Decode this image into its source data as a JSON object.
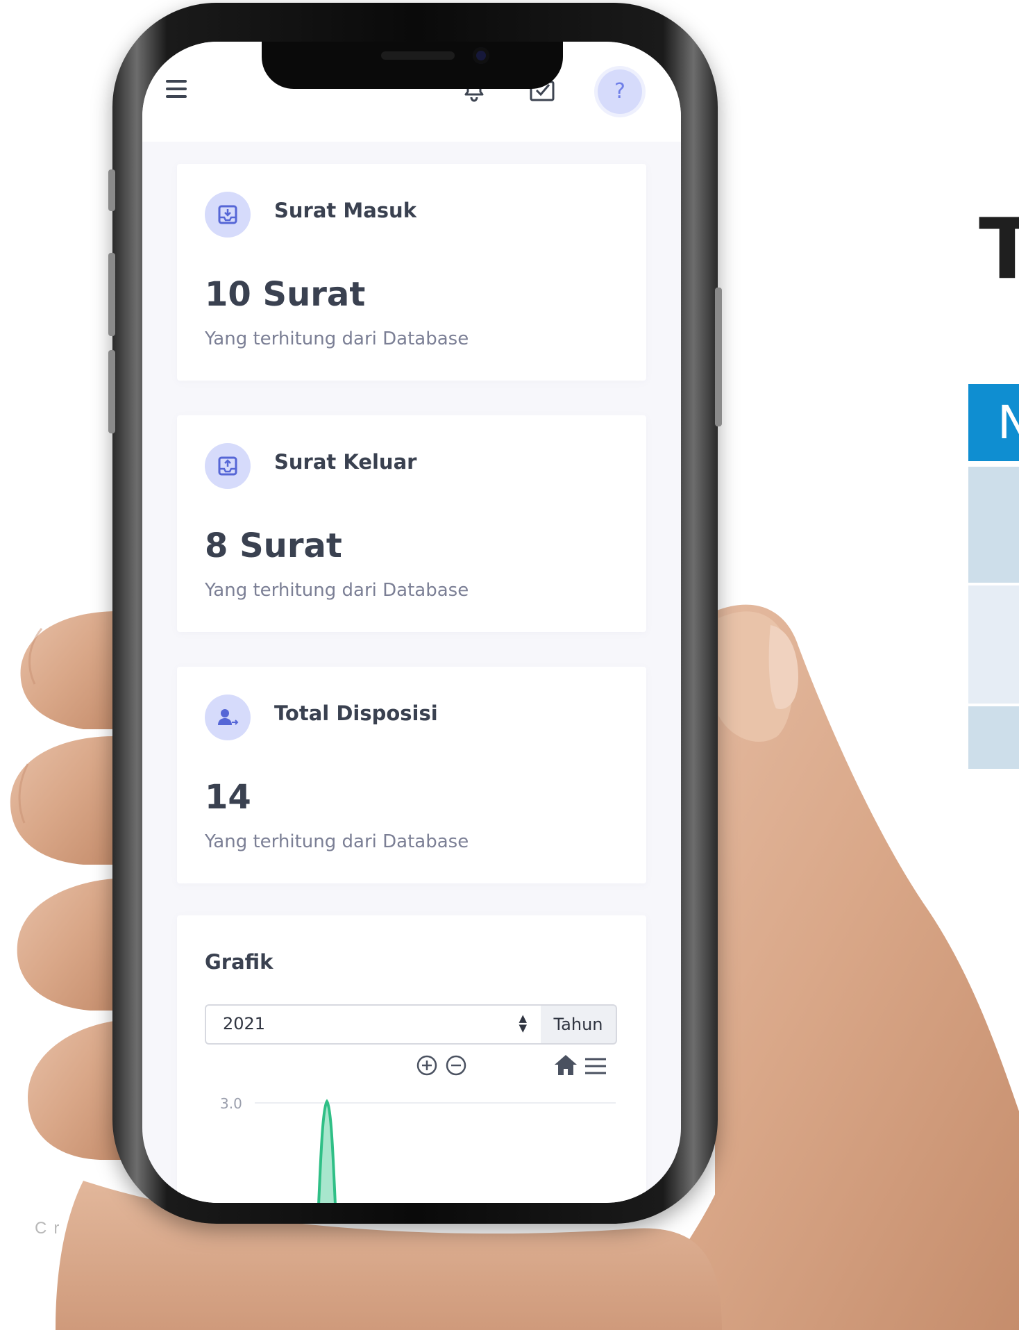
{
  "background": {
    "heading_letter": "T",
    "table_header_letter": "N",
    "caption_fragment": "Cr"
  },
  "topbar": {
    "menu_icon": "hamburger-icon",
    "bell_icon": "bell-icon",
    "inbox_icon": "inbox-check-icon",
    "help_label": "?"
  },
  "cards": [
    {
      "title": "Surat Masuk",
      "value": "10 Surat",
      "subtitle": "Yang terhitung dari Database",
      "icon": "inbox-download-icon"
    },
    {
      "title": "Surat Keluar",
      "value": "8 Surat",
      "subtitle": "Yang terhitung dari Database",
      "icon": "inbox-upload-icon"
    },
    {
      "title": "Total Disposisi",
      "value": "14",
      "subtitle": "Yang terhitung dari Database",
      "icon": "user-forward-icon"
    }
  ],
  "chart": {
    "title": "Grafik",
    "year_value": "2021",
    "year_addon": "Tahun",
    "toolbar": [
      "zoom-in-icon",
      "zoom-out-icon",
      "home-icon",
      "menu-icon"
    ]
  },
  "chart_data": {
    "type": "area",
    "ytick_labels": [
      "3.0"
    ],
    "series_color": "#2fbf86",
    "fill_color": "#a8e6cd"
  }
}
